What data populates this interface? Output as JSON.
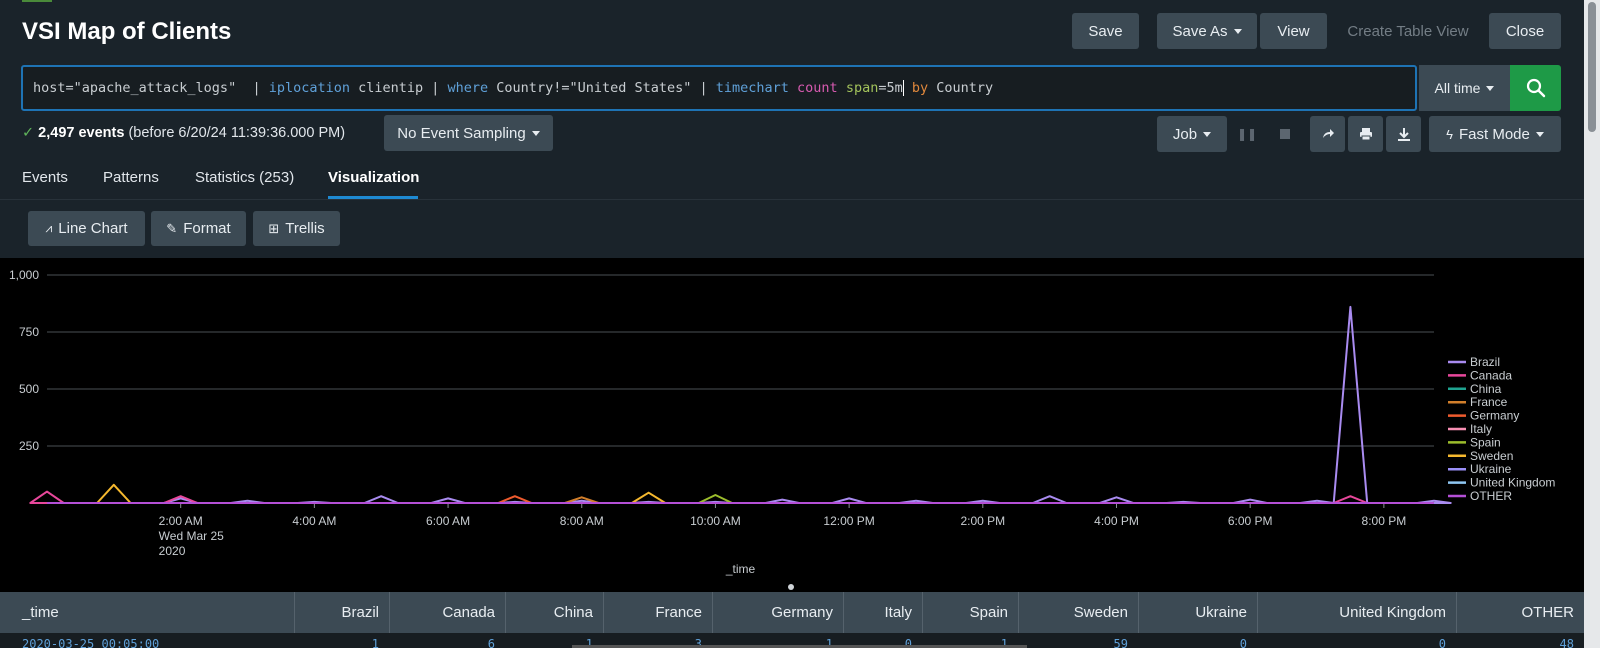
{
  "app": {
    "title": "VSI Map of Clients",
    "actions": {
      "save": "Save",
      "save_as": "Save As",
      "view": "View",
      "create_table_view": "Create Table View",
      "close": "Close"
    }
  },
  "search": {
    "query_tokens": [
      {
        "t": "host=\"apache_attack_logs\"  | ",
        "c": "plain"
      },
      {
        "t": "iplocation",
        "c": "cmd"
      },
      {
        "t": " clientip | ",
        "c": "plain"
      },
      {
        "t": "where",
        "c": "cmd"
      },
      {
        "t": " Country!=\"United States\" | ",
        "c": "plain"
      },
      {
        "t": "timechart",
        "c": "cmd"
      },
      {
        "t": " ",
        "c": "plain"
      },
      {
        "t": "count",
        "c": "fn"
      },
      {
        "t": " ",
        "c": "plain"
      },
      {
        "t": "span",
        "c": "arg"
      },
      {
        "t": "=5m",
        "c": "plain"
      },
      {
        "t": "CURSOR",
        "c": "cursor"
      },
      {
        "t": " ",
        "c": "plain"
      },
      {
        "t": "by",
        "c": "kw"
      },
      {
        "t": " Country",
        "c": "plain"
      }
    ],
    "time_range": "All time",
    "submit_icon": "search-icon"
  },
  "job_status": {
    "check_icon": "checkmark-icon",
    "count": "2,497 events",
    "detail": "(before 6/20/24 11:39:36.000 PM)",
    "sampling": "No Event Sampling",
    "job_menu": "Job",
    "mode": "Fast Mode"
  },
  "tabs": [
    "Events",
    "Patterns",
    "Statistics (253)",
    "Visualization"
  ],
  "active_tab": "Visualization",
  "viz_toolbar": {
    "chart_type": "Line Chart",
    "format": "Format",
    "trellis": "Trellis"
  },
  "chart_data": {
    "type": "line",
    "xlabel": "_time",
    "ylabel": "",
    "ylim": [
      0,
      1000
    ],
    "y_ticks": [
      "1,000",
      "750",
      "500",
      "250"
    ],
    "x_ticks": [
      "2:00 AM",
      "4:00 AM",
      "6:00 AM",
      "8:00 AM",
      "10:00 AM",
      "12:00 PM",
      "2:00 PM",
      "4:00 PM",
      "6:00 PM",
      "8:00 PM"
    ],
    "x_date_line1": "Wed Mar 25",
    "x_date_line2": "2020",
    "x_hours": [
      0.0,
      1.0,
      2.0,
      3.0,
      4.0,
      5.0,
      6.0,
      7.0,
      8.0,
      9.0,
      10.0,
      11.0,
      12.0,
      13.0,
      14.0,
      15.0,
      16.0,
      17.0,
      18.0,
      19.0,
      19.5,
      20.0,
      20.75
    ],
    "legend_position": "right",
    "series": [
      {
        "name": "Brazil",
        "color": "#a98bf0",
        "values": [
          0,
          0,
          20,
          10,
          5,
          30,
          20,
          5,
          10,
          5,
          5,
          15,
          20,
          10,
          10,
          30,
          25,
          5,
          15,
          10,
          860,
          0,
          10
        ]
      },
      {
        "name": "Canada",
        "color": "#e8479b",
        "values": [
          50,
          0,
          30,
          0,
          0,
          0,
          0,
          0,
          0,
          0,
          0,
          0,
          0,
          0,
          0,
          0,
          0,
          0,
          0,
          0,
          30,
          0,
          0
        ]
      },
      {
        "name": "China",
        "color": "#1fa390",
        "values": [
          0,
          0,
          0,
          0,
          0,
          0,
          0,
          0,
          0,
          0,
          0,
          0,
          0,
          0,
          0,
          0,
          0,
          0,
          0,
          0,
          0,
          0,
          0
        ]
      },
      {
        "name": "France",
        "color": "#d27f2b",
        "values": [
          0,
          0,
          0,
          0,
          0,
          0,
          0,
          0,
          25,
          0,
          0,
          0,
          0,
          0,
          0,
          0,
          0,
          0,
          0,
          0,
          0,
          0,
          0
        ]
      },
      {
        "name": "Germany",
        "color": "#ef5b2e",
        "values": [
          0,
          0,
          0,
          0,
          0,
          0,
          0,
          30,
          0,
          0,
          0,
          0,
          0,
          0,
          0,
          0,
          0,
          0,
          0,
          0,
          0,
          0,
          0
        ]
      },
      {
        "name": "Italy",
        "color": "#f78fb3",
        "values": [
          0,
          0,
          0,
          0,
          0,
          0,
          0,
          0,
          0,
          0,
          0,
          0,
          0,
          0,
          0,
          0,
          0,
          0,
          0,
          0,
          0,
          0,
          0
        ]
      },
      {
        "name": "Spain",
        "color": "#9cbd2c",
        "values": [
          0,
          0,
          0,
          0,
          0,
          0,
          0,
          0,
          0,
          0,
          35,
          0,
          0,
          0,
          0,
          0,
          0,
          0,
          0,
          0,
          0,
          0,
          0
        ]
      },
      {
        "name": "Sweden",
        "color": "#f5b82e",
        "values": [
          0,
          80,
          0,
          0,
          0,
          0,
          0,
          0,
          0,
          45,
          0,
          0,
          0,
          0,
          0,
          0,
          0,
          0,
          0,
          0,
          0,
          0,
          0
        ]
      },
      {
        "name": "Ukraine",
        "color": "#9a8ff7",
        "values": [
          0,
          0,
          0,
          0,
          0,
          0,
          0,
          0,
          0,
          0,
          0,
          0,
          0,
          0,
          0,
          0,
          0,
          0,
          0,
          0,
          0,
          0,
          0
        ]
      },
      {
        "name": "United Kingdom",
        "color": "#8fc7f2",
        "values": [
          0,
          0,
          0,
          0,
          0,
          0,
          0,
          0,
          0,
          0,
          0,
          0,
          0,
          0,
          0,
          0,
          0,
          0,
          0,
          0,
          0,
          0,
          0
        ]
      },
      {
        "name": "OTHER",
        "color": "#b44fd6",
        "values": [
          0,
          0,
          0,
          0,
          0,
          0,
          0,
          0,
          0,
          0,
          0,
          0,
          0,
          0,
          0,
          0,
          0,
          0,
          0,
          0,
          0,
          0,
          0
        ]
      }
    ]
  },
  "table": {
    "columns": [
      "_time",
      "Brazil",
      "Canada",
      "China",
      "France",
      "Germany",
      "Italy",
      "Spain",
      "Sweden",
      "Ukraine",
      "United Kingdom",
      "OTHER"
    ],
    "first_row": [
      "2020-03-25 00:05:00",
      "1",
      "6",
      "1",
      "3",
      "1",
      "0",
      "1",
      "59",
      "0",
      "0",
      "48"
    ]
  },
  "toolbar_icons": [
    "pause-icon",
    "stop-icon",
    "share-icon",
    "print-icon",
    "export-icon"
  ]
}
